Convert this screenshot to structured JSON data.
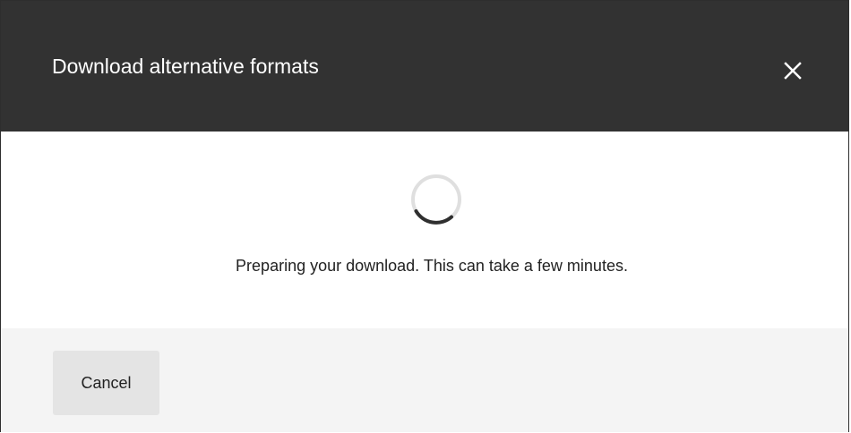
{
  "dialog": {
    "title": "Download alternative formats",
    "message": "Preparing your download. This can take a few minutes.",
    "cancel_label": "Cancel",
    "close_icon": "close-icon",
    "spinner_icon": "loading-spinner-icon"
  },
  "colors": {
    "header_background": "#323232",
    "header_text": "#ffffff",
    "body_background": "#ffffff",
    "footer_background": "#f4f4f4",
    "button_background": "#e4e4e4",
    "text": "#222222"
  }
}
